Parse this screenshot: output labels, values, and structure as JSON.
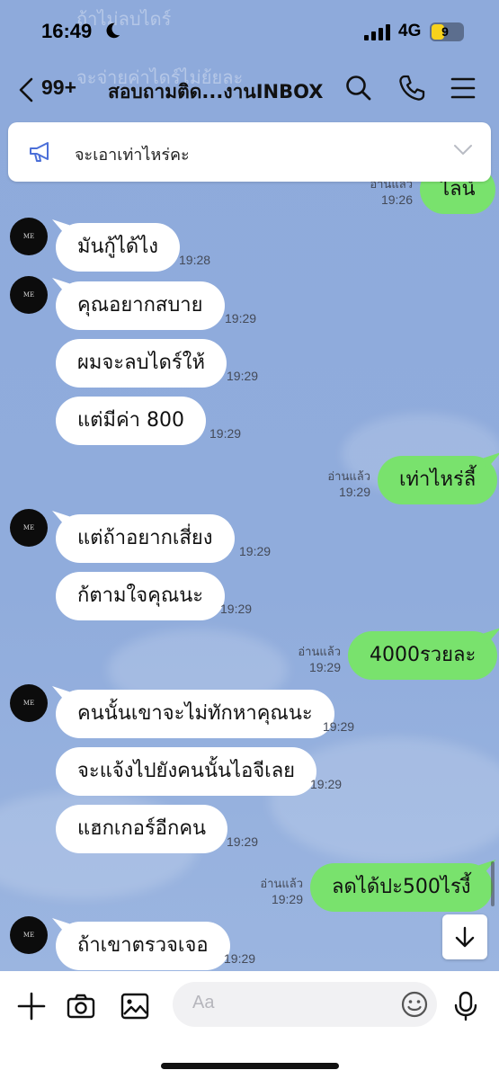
{
  "status_bar": {
    "time": "16:49",
    "network": "4G",
    "battery": "9"
  },
  "header": {
    "unread_count": "99+",
    "title": "สอบถามติด...งานINBOX"
  },
  "ghost_text": [
    "ถ้าไม่ลบไดร์",
    "จะจ่ายค่าไดร์ไม่ย้ยละ"
  ],
  "announcement": {
    "text": "จะเอาเท่าไหร่คะ"
  },
  "avatar_text": "ME",
  "messages": [
    {
      "side": "out",
      "text": "ไลน์",
      "read": "อ่านแล้ว",
      "time": "19:26"
    },
    {
      "side": "in",
      "text": "มันกู้ได้ไง",
      "time": "19:28"
    },
    {
      "side": "in",
      "text": "คุณอยากสบาย",
      "time": "19:29"
    },
    {
      "side": "in",
      "text": "ผมจะลบไดร์ให้",
      "time": "19:29"
    },
    {
      "side": "in",
      "text": "แต่มีค่า 800",
      "time": "19:29"
    },
    {
      "side": "out",
      "text": "เท่าไหร่ลี้",
      "read": "อ่านแล้ว",
      "time": "19:29"
    },
    {
      "side": "in",
      "text": "แต่ถ้าอยากเสี่ยง",
      "time": "19:29"
    },
    {
      "side": "in",
      "text": "ก้ตามใจคุณนะ",
      "time": "19:29"
    },
    {
      "side": "out",
      "text": "4000รวยละ",
      "read": "อ่านแล้ว",
      "time": "19:29"
    },
    {
      "side": "in",
      "text": "คนนั้นเขาจะไม่ทักหาคุณนะ",
      "time": "19:29"
    },
    {
      "side": "in",
      "text": "จะแจ้งไปยังคนนั้นไอจีเลย",
      "time": "19:29"
    },
    {
      "side": "in",
      "text": "แฮกเกอร์อีกคน",
      "time": "19:29"
    },
    {
      "side": "out",
      "text": "ลดได้ปะ500ไรงี้",
      "read": "อ่านแล้ว",
      "time": "19:29"
    },
    {
      "side": "in",
      "text": "ถ้าเขาตรวจเจอ",
      "time": "19:29"
    }
  ],
  "input": {
    "placeholder": "Aa"
  },
  "colors": {
    "chat_bg": "#8ea9d8",
    "outgoing_bubble": "#79e26d",
    "incoming_bubble": "#ffffff"
  },
  "icons": [
    "back-icon",
    "search-icon",
    "phone-icon",
    "menu-icon",
    "megaphone-icon",
    "chevron-down-icon",
    "arrow-down-icon",
    "plus-icon",
    "camera-icon",
    "image-icon",
    "emoji-icon",
    "microphone-icon"
  ]
}
